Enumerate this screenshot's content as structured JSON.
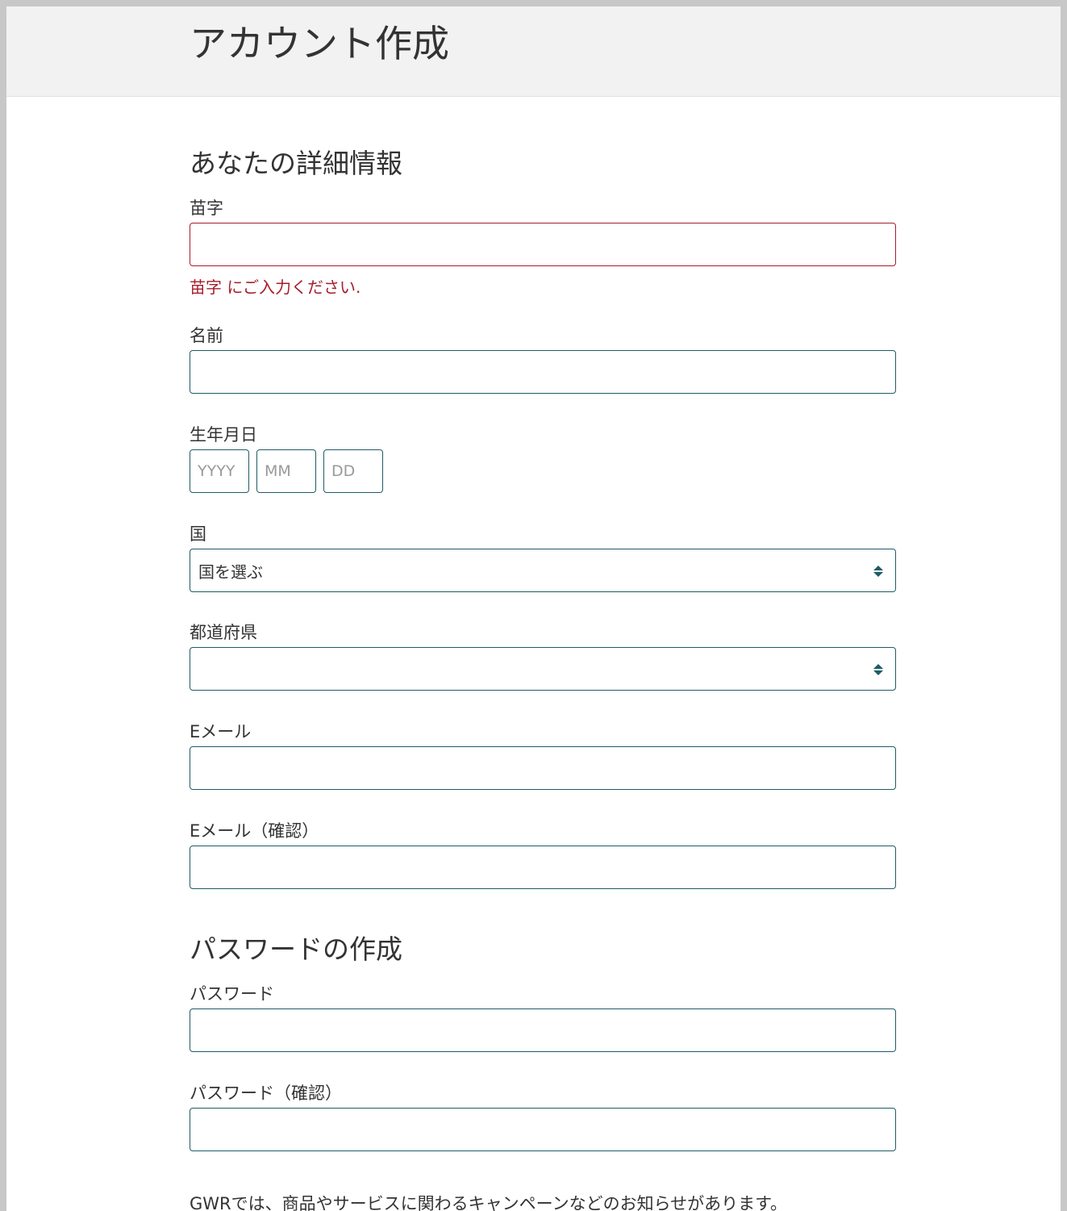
{
  "header": {
    "title": "アカウント作成"
  },
  "details_section": {
    "title": "あなたの詳細情報",
    "last_name": {
      "label": "苗字",
      "value": "",
      "error": "苗字 にご入力ください."
    },
    "first_name": {
      "label": "名前",
      "value": ""
    },
    "birthdate": {
      "label": "生年月日",
      "year_placeholder": "YYYY",
      "month_placeholder": "MM",
      "day_placeholder": "DD"
    },
    "country": {
      "label": "国",
      "selected": "国を選ぶ"
    },
    "prefecture": {
      "label": "都道府県",
      "selected": ""
    },
    "email": {
      "label": "Eメール",
      "value": ""
    },
    "email_confirm": {
      "label": "Eメール（確認）",
      "value": ""
    }
  },
  "password_section": {
    "title": "パスワードの作成",
    "password": {
      "label": "パスワード",
      "value": ""
    },
    "password_confirm": {
      "label": "パスワード（確認）",
      "value": ""
    }
  },
  "footer": {
    "notice": "GWRでは、商品やサービスに関わるキャンペーンなどのお知らせがあります。"
  },
  "colors": {
    "field_border": "#1f5c66",
    "error": "#a51d2d",
    "header_bg": "#f2f2f2",
    "select_arrow": "#1f5c66"
  },
  "icons": {
    "select_arrows": "up-down-caret-icon"
  }
}
